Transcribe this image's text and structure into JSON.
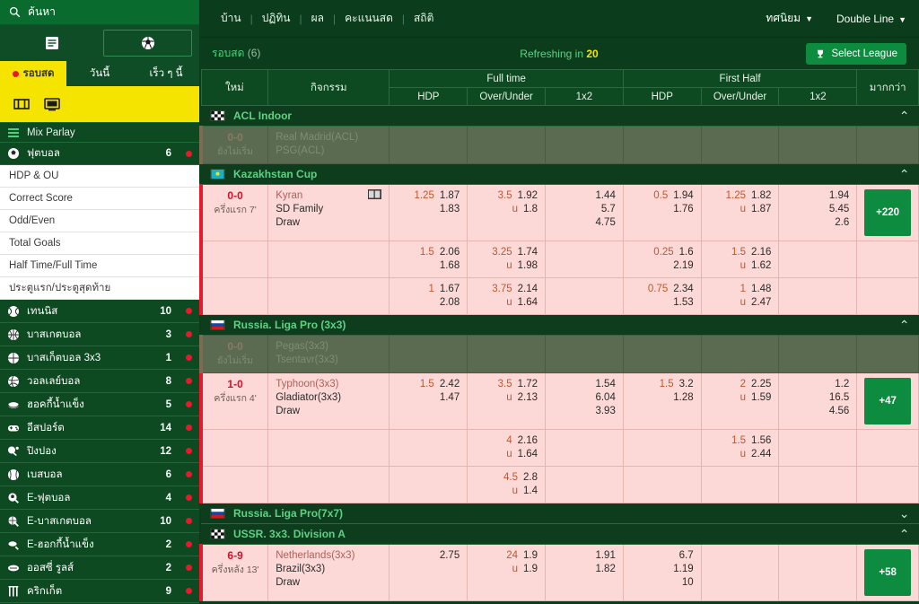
{
  "sidebar": {
    "search_placeholder": "ค้นหา",
    "toggle_buttons": [
      {
        "name": "list-view",
        "icon": "list-icon",
        "selected": false
      },
      {
        "name": "ball-view",
        "icon": "soccer-ball-icon",
        "selected": true
      }
    ],
    "tabs": [
      {
        "label": "รอบสด",
        "active": true,
        "dot": true
      },
      {
        "label": "วันนี้",
        "active": false,
        "dot": false
      },
      {
        "label": "เร็ว ๆ นี้",
        "active": false,
        "dot": false
      }
    ],
    "yellow_icons": [
      "goal-icon",
      "tv-icon"
    ],
    "mix_parlay": "Mix Parlay",
    "football": {
      "label": "ฟุตบอล",
      "count": "6"
    },
    "submenu": [
      "HDP & OU",
      "Correct Score",
      "Odd/Even",
      "Total Goals",
      "Half Time/Full Time",
      "ประตูแรก/ประตูสุดท้าย"
    ],
    "sports": [
      {
        "label": "เทนนิส",
        "count": "10",
        "icon": "tennis-icon"
      },
      {
        "label": "บาสเกตบอล",
        "count": "3",
        "icon": "basketball-icon"
      },
      {
        "label": "บาสเก็ตบอล 3x3",
        "count": "1",
        "icon": "basketball3x3-icon"
      },
      {
        "label": "วอลเลย์บอล",
        "count": "8",
        "icon": "volleyball-icon"
      },
      {
        "label": "ฮอคกี้น้ำแข็ง",
        "count": "5",
        "icon": "hockey-icon"
      },
      {
        "label": "อีสปอร์ต",
        "count": "14",
        "icon": "esports-icon"
      },
      {
        "label": "ปิงปอง",
        "count": "12",
        "icon": "pingpong-icon"
      },
      {
        "label": "เบสบอล",
        "count": "6",
        "icon": "baseball-icon"
      },
      {
        "label": "E-ฟุตบอล",
        "count": "4",
        "icon": "efootball-icon"
      },
      {
        "label": "E-บาสเกตบอล",
        "count": "10",
        "icon": "ebasketball-icon"
      },
      {
        "label": "E-ฮอกกี้น้ำแข็ง",
        "count": "2",
        "icon": "ehockey-icon"
      },
      {
        "label": "ออสซี่ รูลส์",
        "count": "2",
        "icon": "aussierules-icon"
      },
      {
        "label": "คริกเก็ต",
        "count": "9",
        "icon": "cricket-icon"
      }
    ]
  },
  "topnav": {
    "items": [
      "บ้าน",
      "ปฏิทิน",
      "ผล",
      "คะแนนสด",
      "สถิติ"
    ],
    "odds_format": "ทศนิยม",
    "line_mode": "Double Line"
  },
  "subbar": {
    "live_label": "รอบสด",
    "live_count": "(6)",
    "refresh_prefix": "Refreshing in",
    "refresh_seconds": "20",
    "select_league": "Select League",
    "trophy_icon": "trophy-icon"
  },
  "table": {
    "headers": {
      "new": "ใหม่",
      "event": "กิจกรรม",
      "full_time": "Full time",
      "first_half": "First Half",
      "more": "มากกว่า",
      "hdp": "HDP",
      "over_under": "Over/Under",
      "one_x_two": "1x2"
    }
  },
  "leagues": [
    {
      "name": "ACL Indoor",
      "flag": "checkered-flag-icon",
      "expanded": true,
      "chevron": "chevron-up-icon",
      "matches": [
        {
          "dim": true,
          "score": "0-0",
          "minute": "ยังไม่เริ่ม",
          "team1": "Real Madrid(ACL)",
          "team2": "PSG(ACL)",
          "team3": "",
          "badge": false,
          "ft_hdp": {
            "line": "",
            "odds": [
              "",
              ""
            ]
          },
          "ft_ou": {
            "line": "",
            "u": "",
            "odds": [
              "",
              ""
            ]
          },
          "ft_1x2": {
            "odds": [
              "",
              "",
              ""
            ]
          },
          "hh_hdp": {
            "line": "",
            "odds": [
              "",
              ""
            ]
          },
          "hh_ou": {
            "line": "",
            "u": "",
            "odds": [
              "",
              ""
            ]
          },
          "hh_1x2": {
            "odds": [
              "",
              "",
              ""
            ]
          },
          "more": "",
          "subrows": []
        }
      ]
    },
    {
      "name": "Kazakhstan Cup",
      "flag": "kazakhstan-flag-icon",
      "expanded": true,
      "chevron": "chevron-up-icon",
      "matches": [
        {
          "dim": false,
          "score": "0-0",
          "minute": "ครึ่งแรก 7'",
          "team1": "Kyran",
          "team2": "SD Family",
          "team3": "Draw",
          "badge": true,
          "ft_hdp": {
            "line": "1.25",
            "odds": [
              "1.87",
              "1.83"
            ]
          },
          "ft_ou": {
            "line": "3.5",
            "u": "u",
            "odds": [
              "1.92",
              "1.8"
            ]
          },
          "ft_1x2": {
            "odds": [
              "1.44",
              "5.7",
              "4.75"
            ]
          },
          "hh_hdp": {
            "line": "0.5",
            "odds": [
              "1.94",
              "1.76"
            ]
          },
          "hh_ou": {
            "line": "1.25",
            "u": "u",
            "odds": [
              "1.82",
              "1.87"
            ]
          },
          "hh_1x2": {
            "odds": [
              "1.94",
              "5.45",
              "2.6"
            ]
          },
          "more": "+220",
          "subrows": [
            {
              "ft_hdp": {
                "line": "1.5",
                "odds": [
                  "2.06",
                  "1.68"
                ]
              },
              "ft_ou": {
                "line": "3.25",
                "u": "u",
                "odds": [
                  "1.74",
                  "1.98"
                ]
              },
              "ft_1x2": {
                "odds": []
              },
              "hh_hdp": {
                "line": "0.25",
                "odds": [
                  "1.6",
                  "2.19"
                ]
              },
              "hh_ou": {
                "line": "1.5",
                "u": "u",
                "odds": [
                  "2.16",
                  "1.62"
                ]
              },
              "hh_1x2": {
                "odds": []
              }
            },
            {
              "ft_hdp": {
                "line": "1",
                "odds": [
                  "1.67",
                  "2.08"
                ]
              },
              "ft_ou": {
                "line": "3.75",
                "u": "u",
                "odds": [
                  "2.14",
                  "1.64"
                ]
              },
              "ft_1x2": {
                "odds": []
              },
              "hh_hdp": {
                "line": "0.75",
                "odds": [
                  "2.34",
                  "1.53"
                ]
              },
              "hh_ou": {
                "line": "1",
                "u": "u",
                "odds": [
                  "1.48",
                  "2.47"
                ]
              },
              "hh_1x2": {
                "odds": []
              }
            }
          ]
        }
      ]
    },
    {
      "name": "Russia. Liga Pro (3x3)",
      "flag": "russia-flag-icon",
      "expanded": true,
      "chevron": "chevron-up-icon",
      "matches": [
        {
          "dim": true,
          "score": "0-0",
          "minute": "ยังไม่เริ่ม",
          "team1": "Pegas(3x3)",
          "team2": "Tsentavr(3x3)",
          "team3": "",
          "badge": false,
          "ft_hdp": {
            "line": "",
            "odds": [
              "",
              ""
            ]
          },
          "ft_ou": {
            "line": "",
            "u": "",
            "odds": [
              "",
              ""
            ]
          },
          "ft_1x2": {
            "odds": []
          },
          "hh_hdp": {
            "line": "",
            "odds": [
              "",
              ""
            ]
          },
          "hh_ou": {
            "line": "",
            "u": "",
            "odds": [
              "",
              ""
            ]
          },
          "hh_1x2": {
            "odds": []
          },
          "more": "",
          "subrows": []
        },
        {
          "dim": false,
          "score": "1-0",
          "minute": "ครึ่งแรก 4'",
          "team1": "Typhoon(3x3)",
          "team2": "Gladiator(3x3)",
          "team3": "Draw",
          "badge": false,
          "ft_hdp": {
            "line": "1.5",
            "odds": [
              "2.42",
              "1.47"
            ]
          },
          "ft_ou": {
            "line": "3.5",
            "u": "u",
            "odds": [
              "1.72",
              "2.13"
            ]
          },
          "ft_1x2": {
            "odds": [
              "1.54",
              "6.04",
              "3.93"
            ]
          },
          "hh_hdp": {
            "line": "1.5",
            "odds": [
              "3.2",
              "1.28"
            ]
          },
          "hh_ou": {
            "line": "2",
            "u": "u",
            "odds": [
              "2.25",
              "1.59"
            ]
          },
          "hh_1x2": {
            "odds": [
              "1.2",
              "16.5",
              "4.56"
            ]
          },
          "more": "+47",
          "subrows": [
            {
              "ft_hdp": {
                "line": "",
                "odds": []
              },
              "ft_ou": {
                "line": "4",
                "u": "u",
                "odds": [
                  "2.16",
                  "1.64"
                ]
              },
              "ft_1x2": {
                "odds": []
              },
              "hh_hdp": {
                "line": "",
                "odds": []
              },
              "hh_ou": {
                "line": "1.5",
                "u": "u",
                "odds": [
                  "1.56",
                  "2.44"
                ]
              },
              "hh_1x2": {
                "odds": []
              }
            },
            {
              "ft_hdp": {
                "line": "",
                "odds": []
              },
              "ft_ou": {
                "line": "4.5",
                "u": "u",
                "odds": [
                  "2.8",
                  "1.4"
                ]
              },
              "ft_1x2": {
                "odds": []
              },
              "hh_hdp": {
                "line": "",
                "odds": []
              },
              "hh_ou": {
                "line": "",
                "u": "",
                "odds": []
              },
              "hh_1x2": {
                "odds": []
              }
            }
          ]
        }
      ]
    },
    {
      "name": "Russia. Liga Pro(7x7)",
      "flag": "russia-flag-icon",
      "expanded": false,
      "chevron": "chevron-down-icon",
      "matches": []
    },
    {
      "name": "USSR. 3x3. Division A",
      "flag": "checkered-flag-icon",
      "expanded": true,
      "chevron": "chevron-up-icon",
      "matches": [
        {
          "dim": false,
          "score": "6-9",
          "minute": "ครึ่งหลัง 13'",
          "team1": "Netherlands(3x3)",
          "team2": "Brazil(3x3)",
          "team3": "Draw",
          "badge": false,
          "ft_hdp": {
            "line": "",
            "odds": [
              "",
              "2.75"
            ]
          },
          "ft_ou": {
            "line": "24",
            "u": "u",
            "odds": [
              "1.9",
              "1.9"
            ]
          },
          "ft_1x2": {
            "odds": [
              "1.91",
              "1.82",
              ""
            ]
          },
          "hh_hdp": {
            "line": "",
            "odds": []
          },
          "hh_ou": {
            "line": "",
            "u": "",
            "odds": []
          },
          "hh_1x2": {
            "odds": []
          },
          "extra_1x2": {
            "odds": [
              "6.7",
              "1.19",
              "10"
            ]
          },
          "more": "+58",
          "subrows": []
        }
      ]
    }
  ]
}
